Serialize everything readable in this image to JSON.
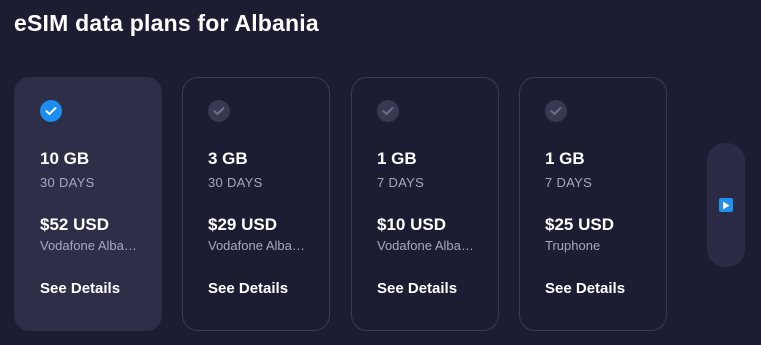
{
  "page": {
    "title": "eSIM data plans for Albania"
  },
  "colors": {
    "background": "#1c1c33",
    "selected_card": "#2e2e48",
    "accent": "#1b8ef0",
    "muted_text": "#a7a7bd"
  },
  "plans": [
    {
      "selected": true,
      "data": "10 GB",
      "days": "30 DAYS",
      "price": "$52 USD",
      "carrier": "Vodafone Albania",
      "details_label": "See Details"
    },
    {
      "selected": false,
      "data": "3 GB",
      "days": "30 DAYS",
      "price": "$29 USD",
      "carrier": "Vodafone Albania",
      "details_label": "See Details"
    },
    {
      "selected": false,
      "data": "1 GB",
      "days": "7 DAYS",
      "price": "$10 USD",
      "carrier": "Vodafone Albania",
      "details_label": "See Details"
    },
    {
      "selected": false,
      "data": "1 GB",
      "days": "7 DAYS",
      "price": "$25 USD",
      "carrier": "Truphone",
      "details_label": "See Details"
    }
  ],
  "navigation": {
    "next_icon": "play-arrow-icon"
  }
}
